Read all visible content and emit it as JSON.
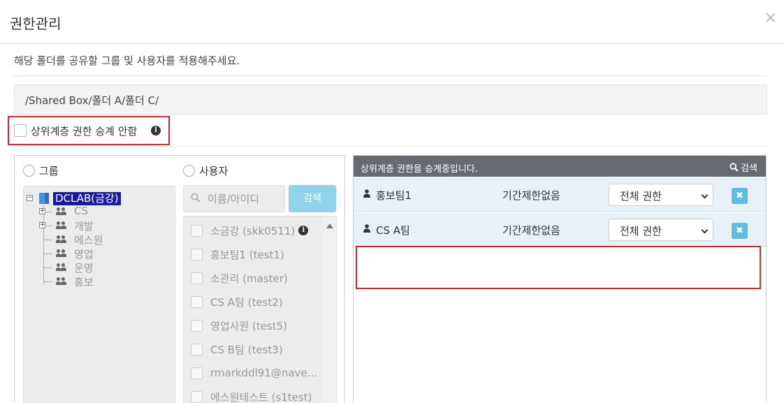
{
  "modal": {
    "title": "권한관리",
    "close": "×"
  },
  "description": "해당 폴더를 공유할 그룹 및 사용자를 적용해주세요.",
  "path": "/Shared Box/폴더 A/폴더 C/",
  "inherit": {
    "label": "상위계층 권한 승계 안함",
    "checked": false
  },
  "left": {
    "group_radio": "그룹",
    "user_radio": "사용자",
    "tree": {
      "root": "DCLAB(금강)",
      "items": [
        {
          "label": "CS",
          "expandable": true
        },
        {
          "label": "개발",
          "expandable": true
        },
        {
          "label": "에스원",
          "expandable": false
        },
        {
          "label": "영업",
          "expandable": false
        },
        {
          "label": "운영",
          "expandable": false
        },
        {
          "label": "홍보",
          "expandable": false
        }
      ]
    },
    "search": {
      "placeholder": "이름/아이디",
      "button": "검색"
    },
    "users": [
      {
        "name": "소금강 (skk0511)",
        "info": true
      },
      {
        "name": "홍보팀1 (test1)",
        "info": false
      },
      {
        "name": "소관리 (master)",
        "info": false
      },
      {
        "name": "CS A팀 (test2)",
        "info": false
      },
      {
        "name": "영업사원 (test5)",
        "info": false
      },
      {
        "name": "CS B팀 (test3)",
        "info": false
      },
      {
        "name": "rmarkddl91@nave…",
        "info": false
      },
      {
        "name": "에스원테스트 (s1test)",
        "info": false
      }
    ]
  },
  "right": {
    "header": "상위계층 권한을 승계중입니다.",
    "search_label": "검색",
    "rows": [
      {
        "name": "홍보팀1",
        "period": "기간제한없음",
        "permission": "전체 권한"
      },
      {
        "name": "CS A팀",
        "period": "기간제한없음",
        "permission": "전체 권한"
      }
    ]
  },
  "colors": {
    "highlight_border": "#d9242b",
    "accent": "#5bc0de",
    "header_bg": "#666b72"
  }
}
